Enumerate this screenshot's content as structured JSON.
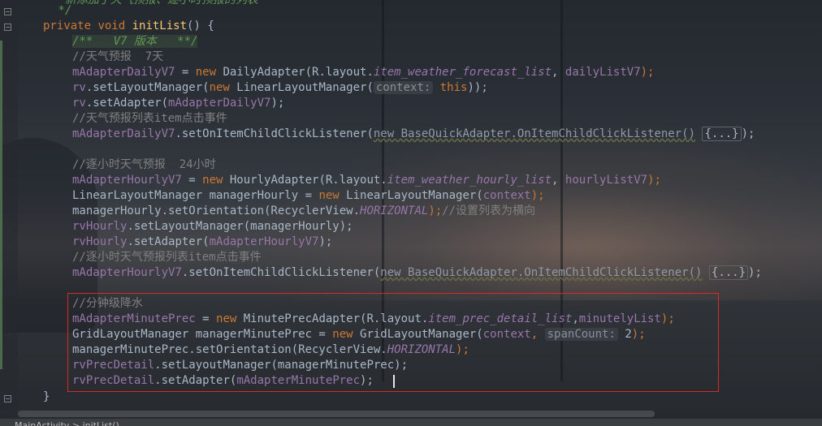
{
  "editor": {
    "lines": {
      "l0": {
        "text": "  新添加了天气预报、逐小时预报的列表"
      },
      "l1": {
        "text": " */"
      },
      "l2": {
        "kw1": "private ",
        "kw2": "void ",
        "fn": "initList",
        "rest": "() {"
      },
      "l3": {
        "doc": "/**   V7 版本   **/"
      },
      "l4": {
        "comment": "//天气预报  7天"
      },
      "l5": {
        "field": "mAdapterDailyV7",
        "eq": " = ",
        "kw": "new ",
        "cls": "DailyAdapter(R.layout.",
        "ifield": "item_weather_forecast_list",
        "rest": ", ",
        "field2": "dailyListV7",
        "end": ");"
      },
      "l6": {
        "field": "rv",
        "mid": ".setLayoutManager(",
        "kw": "new ",
        "cls": "LinearLayoutManager(",
        "hint": "context:",
        "kw2": " this",
        "end": "));"
      },
      "l7": {
        "field": "rv",
        "mid": ".setAdapter(",
        "field2": "mAdapterDailyV7",
        "end": ");"
      },
      "l8": {
        "comment": "//天气预报列表item点击事件"
      },
      "l9": {
        "field": "mAdapterDailyV7",
        "mid": ".setOnItemChildClickListener(",
        "grey": "new BaseQuickAdapter.OnItemChildClickListener()",
        "fold": "{...}",
        "end": ");"
      },
      "l10": {
        "comment": "//逐小时天气预报  24小时"
      },
      "l11": {
        "field": "mAdapterHourlyV7",
        "eq": " = ",
        "kw": "new ",
        "cls": "HourlyAdapter(R.layout.",
        "ifield": "item_weather_hourly_list",
        "rest": ", ",
        "field2": "hourlyListV7",
        "end": ");"
      },
      "l12": {
        "a": "LinearLayoutManager managerHourly = ",
        "kw": "new ",
        "b": "LinearLayoutManager(",
        "field": "context",
        "end": ");"
      },
      "l13": {
        "a": "managerHourly.setOrientation(RecyclerView.",
        "ifield": "HORIZONTAL",
        "end": ");",
        "comment": "//设置列表为横向"
      },
      "l14": {
        "field": "rvHourly",
        "mid": ".setLayoutManager(managerHourly);"
      },
      "l15": {
        "field": "rvHourly",
        "mid": ".setAdapter(",
        "field2": "mAdapterHourlyV7",
        "end": ");"
      },
      "l16": {
        "comment": "//逐小时天气预报列表item点击事件"
      },
      "l17": {
        "field": "mAdapterHourlyV7",
        "mid": ".setOnItemChildClickListener(",
        "grey": "new BaseQuickAdapter.OnItemChildClickListener()",
        "fold": "{...}",
        "end": ");"
      },
      "l18": {
        "comment": "//分钟级降水"
      },
      "l19": {
        "field": "mAdapterMinutePrec",
        "eq": " = ",
        "kw": "new ",
        "cls": "MinutePrecAdapter(R.layout.",
        "ifield": "item_prec_detail_list",
        "rest": ",",
        "field2": "minutelyList",
        "end": ");"
      },
      "l20": {
        "a": "GridLayoutManager managerMinutePrec = ",
        "kw": "new ",
        "b": "GridLayoutManager(",
        "field": "context",
        "c": ", ",
        "hint": "spanCount:",
        "num": " 2",
        "end": ");"
      },
      "l21": {
        "a": "managerMinutePrec.setOrientation(RecyclerView.",
        "ifield": "HORIZONTAL",
        "end": ");"
      },
      "l22": {
        "field": "rvPrecDetail",
        "mid": ".setLayoutManager(managerMinutePrec);"
      },
      "l23": {
        "field": "rvPrecDetail",
        "mid": ".setAdapter(",
        "field2": "mAdapterMinutePrec",
        "end": ");"
      },
      "l24": {
        "text": "}"
      }
    }
  },
  "statusbar": {
    "breadcrumb": "MainActivity > initList()"
  },
  "colors": {
    "keyword": "#cc7832",
    "function": "#ffc66d",
    "comment": "#808080",
    "doc": "#629755",
    "field": "#9876aa",
    "text": "#a9b7c6",
    "highlight": "#d92a2a"
  }
}
